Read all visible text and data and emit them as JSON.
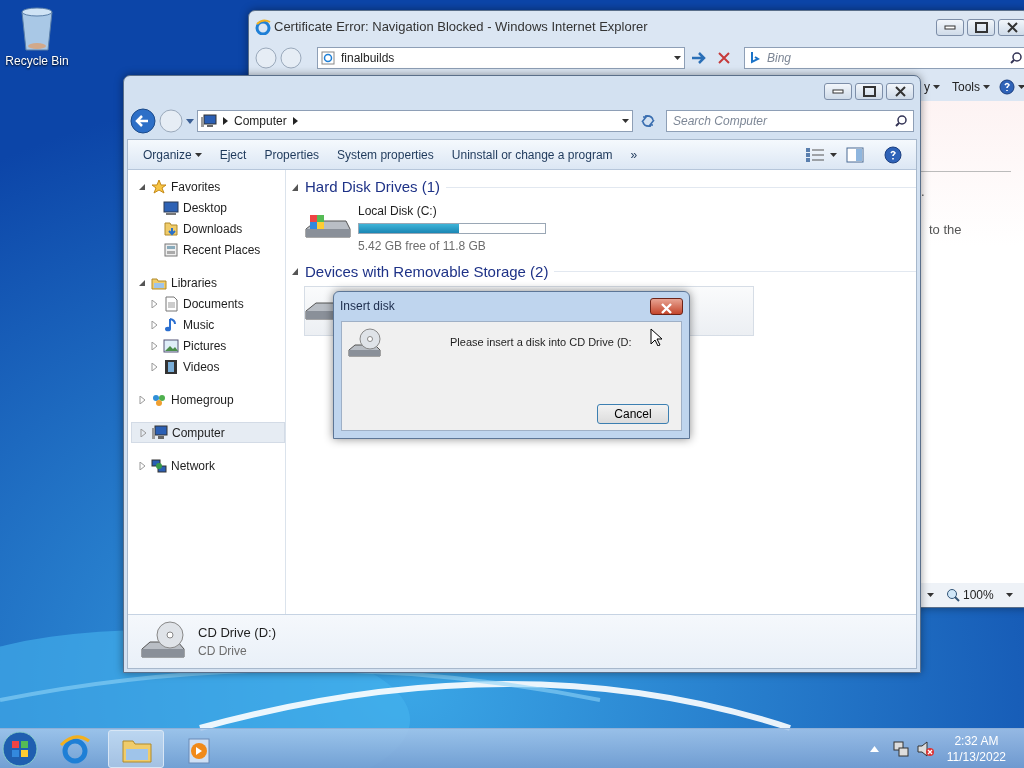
{
  "desktop": {
    "icons": [
      {
        "label": "Recycle Bin"
      }
    ]
  },
  "ie_window": {
    "title": "Certificate Error: Navigation Blocked - Windows Internet Explorer",
    "address": "finalbuilds",
    "search_placeholder": "Bing",
    "menu": [
      "y",
      "Tools"
    ],
    "page_text": [
      ".",
      "to the"
    ],
    "zoom": "100%"
  },
  "explorer": {
    "breadcrumb": "Computer",
    "search_placeholder": "Search Computer",
    "commands": [
      {
        "label": "Organize",
        "dropdown": true
      },
      {
        "label": "Eject",
        "dropdown": false
      },
      {
        "label": "Properties",
        "dropdown": false
      },
      {
        "label": "System properties",
        "dropdown": false
      },
      {
        "label": "Uninstall or change a program",
        "dropdown": false
      }
    ],
    "more": "»",
    "nav": [
      {
        "label": "Favorites",
        "expanded": true,
        "selected": false,
        "children": [
          {
            "label": "Desktop",
            "selected": false
          },
          {
            "label": "Downloads",
            "selected": false
          },
          {
            "label": "Recent Places",
            "selected": false
          }
        ]
      },
      {
        "label": "Libraries",
        "expanded": true,
        "selected": false,
        "children": [
          {
            "label": "Documents",
            "expanded": false,
            "selected": false
          },
          {
            "label": "Music",
            "expanded": false,
            "selected": false
          },
          {
            "label": "Pictures",
            "expanded": false,
            "selected": false
          },
          {
            "label": "Videos",
            "expanded": false,
            "selected": false
          }
        ]
      },
      {
        "label": "Homegroup",
        "expanded": false,
        "selected": false
      },
      {
        "label": "Computer",
        "expanded": false,
        "selected": true
      },
      {
        "label": "Network",
        "expanded": false,
        "selected": false
      }
    ],
    "groups": [
      {
        "title": "Hard Disk Drives (1)",
        "items": [
          {
            "name": "Local Disk (C:)",
            "level": 0.54,
            "info": "5.42 GB free of 11.8 GB",
            "selected": false
          }
        ]
      },
      {
        "title": "Devices with Removable Storage (2)",
        "items": [
          {
            "selected": true
          }
        ]
      }
    ],
    "details": {
      "name": "CD Drive (D:)",
      "type": "CD Drive"
    }
  },
  "dialog": {
    "title": "Insert disk",
    "message": "Please insert a disk into CD Drive (D:",
    "button": "Cancel"
  },
  "taskbar": {
    "buttons": [
      {
        "selected": false
      },
      {
        "selected": true
      },
      {
        "selected": false
      }
    ],
    "time": "2:32 AM",
    "date": "11/13/2022"
  }
}
